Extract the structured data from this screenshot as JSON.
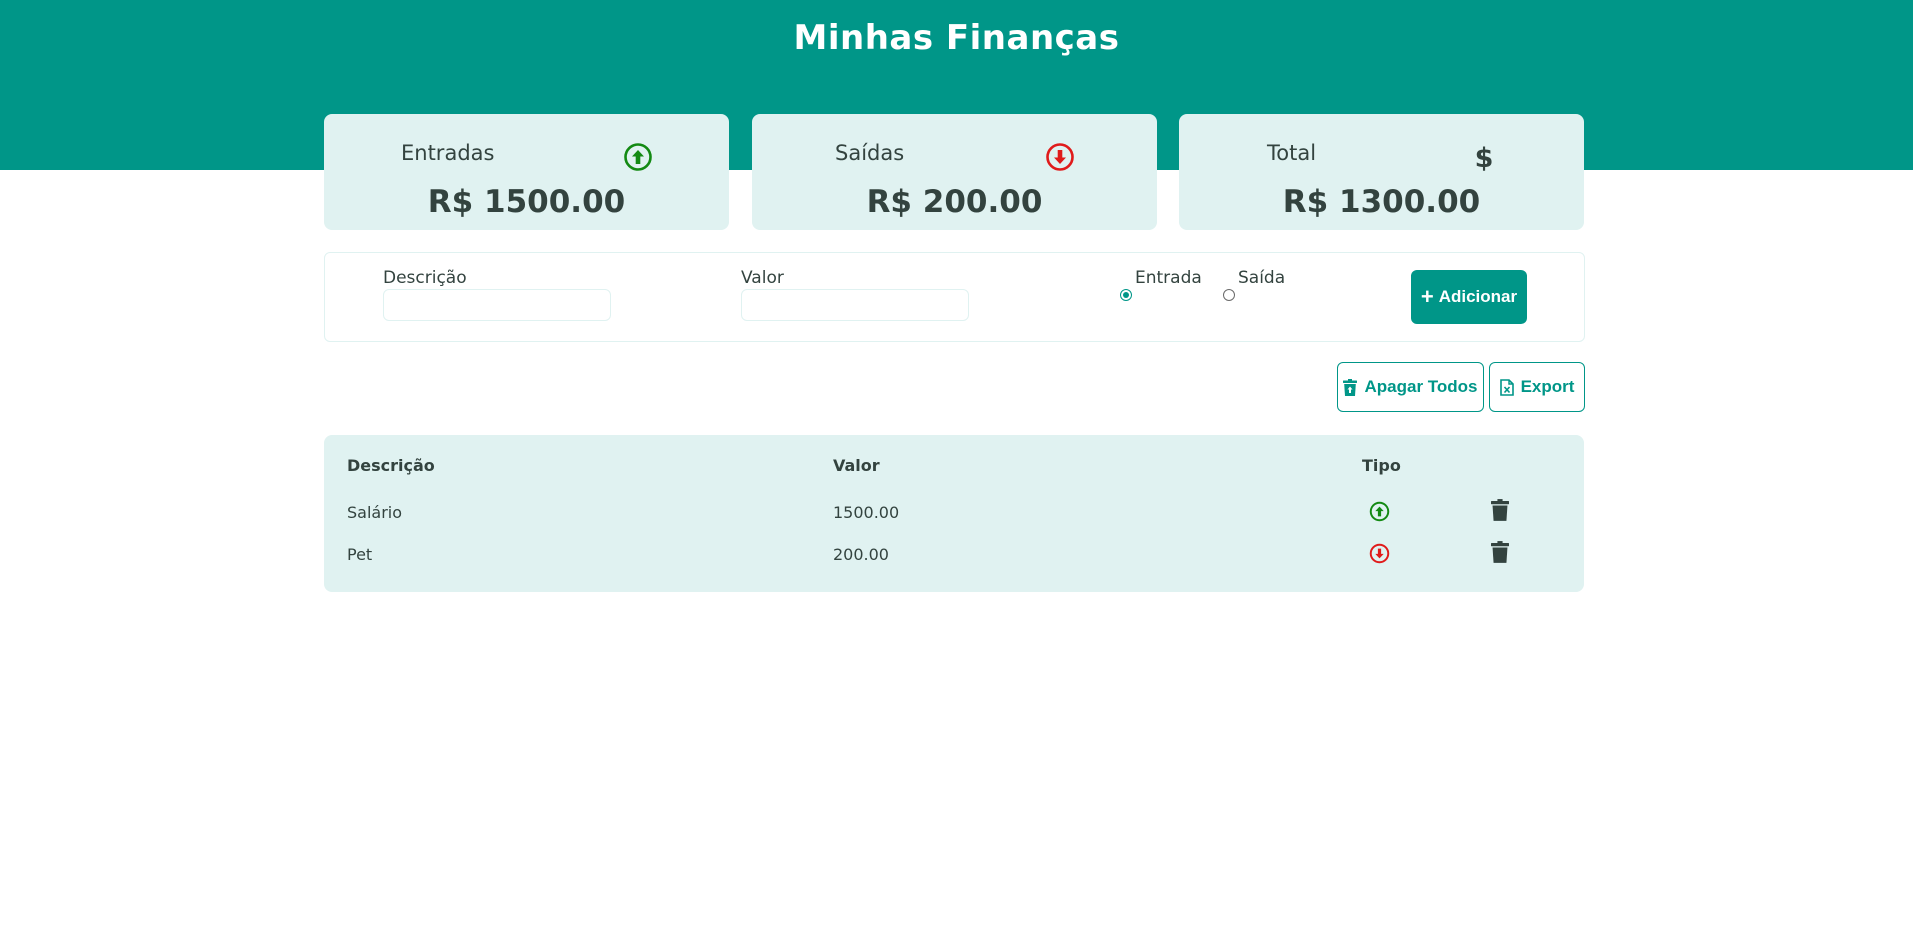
{
  "header": {
    "title": "Minhas Finanças",
    "background_color": "#009688"
  },
  "summary": {
    "income": {
      "label": "Entradas",
      "value": "R$ 1500.00",
      "icon": "arrow-up-circle-icon",
      "color": "#138a13"
    },
    "expense": {
      "label": "Saídas",
      "value": "R$ 200.00",
      "icon": "arrow-down-circle-icon",
      "color": "#e01b1b"
    },
    "total": {
      "label": "Total",
      "value": "R$ 1300.00",
      "icon": "dollar-icon"
    }
  },
  "form": {
    "description_label": "Descrição",
    "description_value": "",
    "value_label": "Valor",
    "value_value": "",
    "type_income_label": "Entrada",
    "type_expense_label": "Saída",
    "selected_type": "Entrada",
    "add_button_label": "Adicionar",
    "add_button_icon": "plus-icon"
  },
  "actions": {
    "delete_all_label": "Apagar Todos",
    "delete_all_icon": "trash-icon",
    "export_label": "Export",
    "export_icon": "excel-file-icon"
  },
  "table": {
    "columns": [
      "Descrição",
      "Valor",
      "Tipo"
    ],
    "rows": [
      {
        "description": "Salário",
        "value": "1500.00",
        "type": "entrada",
        "type_icon": "arrow-up-circle-icon",
        "delete_icon": "trash-icon"
      },
      {
        "description": "Pet",
        "value": "200.00",
        "type": "saida",
        "type_icon": "arrow-down-circle-icon",
        "delete_icon": "trash-icon"
      }
    ]
  },
  "colors": {
    "accent": "#009688",
    "card_background": "#e0f2f1",
    "text": "#33433f",
    "income": "#138a13",
    "expense": "#e01b1b"
  }
}
